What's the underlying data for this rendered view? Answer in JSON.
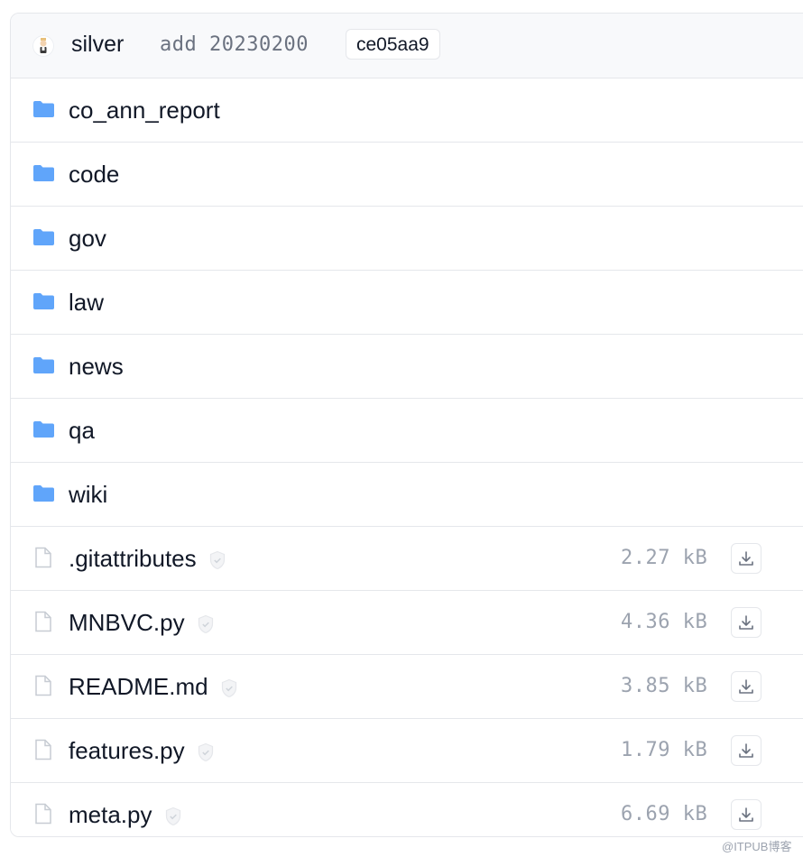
{
  "commit": {
    "author": "silver",
    "message": "add 20230200",
    "hash": "ce05aa9"
  },
  "folders": [
    {
      "name": "co_ann_report",
      "icon": "folder-icon"
    },
    {
      "name": "code",
      "icon": "folder-icon"
    },
    {
      "name": "gov",
      "icon": "folder-icon"
    },
    {
      "name": "law",
      "icon": "folder-icon"
    },
    {
      "name": "news",
      "icon": "folder-icon"
    },
    {
      "name": "qa",
      "icon": "folder-icon"
    },
    {
      "name": "wiki",
      "icon": "folder-icon"
    }
  ],
  "files": [
    {
      "name": ".gitattributes",
      "size": "2.27 kB",
      "icon": "file-icon"
    },
    {
      "name": "MNBVC.py",
      "size": "4.36 kB",
      "icon": "file-icon"
    },
    {
      "name": "README.md",
      "size": "3.85 kB",
      "icon": "file-icon"
    },
    {
      "name": "features.py",
      "size": "1.79 kB",
      "icon": "file-icon"
    },
    {
      "name": "meta.py",
      "size": "6.69 kB",
      "icon": "file-icon"
    }
  ],
  "watermark": "@ITPUB博客",
  "colors": {
    "folder": "#60a5fa",
    "file_outline": "#c7ccd3",
    "border": "#e5e7eb",
    "header_bg": "#f8f9fb",
    "size_text": "#9ca3af"
  }
}
